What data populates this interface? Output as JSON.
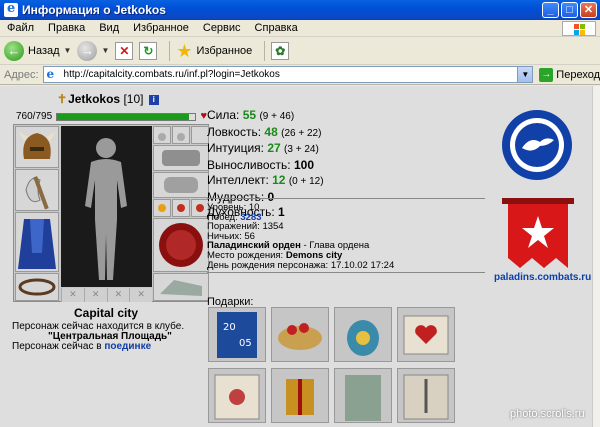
{
  "window": {
    "title": "Информация о Jetkokos"
  },
  "menu": [
    "Файл",
    "Правка",
    "Вид",
    "Избранное",
    "Сервис",
    "Справка"
  ],
  "toolbar": {
    "back_label": "Назад",
    "favorites_label": "Избранное"
  },
  "address": {
    "label": "Адрес:",
    "url": "http://capitalcity.combats.ru/inf.pl?login=Jetkokos",
    "go_label": "Переход"
  },
  "character": {
    "name": "Jetkokos",
    "level": "[10]",
    "hp": "760/795",
    "hp_fraction": 0.956,
    "city": "Capital city",
    "club_line": "Персонаж сейчас находится в клубе.",
    "club_place": "\"Центральная Площадь\"",
    "duel_prefix": "Персонаж сейчас в",
    "duel_link": "поединке"
  },
  "stats": [
    {
      "label": "Сила:",
      "value": "55",
      "extra": "(9 + 46)",
      "green": true
    },
    {
      "label": "Ловкость:",
      "value": "48",
      "extra": "(26 + 22)",
      "green": true
    },
    {
      "label": "Интуиция:",
      "value": "27",
      "extra": "(3 + 24)",
      "green": true
    },
    {
      "label": "Выносливость:",
      "value": "100",
      "extra": "",
      "green": false
    },
    {
      "label": "Интеллект:",
      "value": "12",
      "extra": "(0 + 12)",
      "green": true
    },
    {
      "label": "Мудрость:",
      "value": "0",
      "extra": "",
      "green": false
    },
    {
      "label": "Духовность:",
      "value": "1",
      "extra": "",
      "green": false
    }
  ],
  "info": {
    "level": "Уровень: 10",
    "wins_label": "Побед:",
    "wins": "3283",
    "losses": "Поражений: 1354",
    "draws": "Ничьих: 56",
    "order": "Паладинский орден",
    "order_rank": " - Глава ордена",
    "birthplace_label": "Место рождения:",
    "birthplace": "Demons city",
    "birthday": "День рождения персонажа: 17.10.02 17:24"
  },
  "gifts_label": "Подарки:",
  "org_link": "paladins.combats.ru",
  "watermark": "photo.scrolls.ru"
}
